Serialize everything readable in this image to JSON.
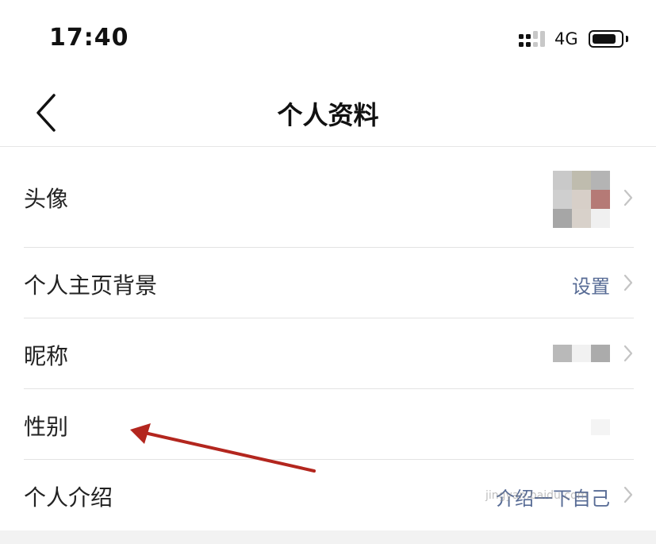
{
  "status_bar": {
    "time": "17:40",
    "network": "4G",
    "battery_level": 0.85
  },
  "nav": {
    "title": "个人资料",
    "back_icon": "chevron-left-icon"
  },
  "rows": [
    {
      "label": "头像",
      "value": "",
      "icon": "chevron-right-icon"
    },
    {
      "label": "个人主页背景",
      "value": "设置",
      "icon": "chevron-right-icon"
    },
    {
      "label": "昵称",
      "value": "",
      "icon": "chevron-right-icon"
    },
    {
      "label": "性别",
      "value": "",
      "icon": ""
    },
    {
      "label": "个人介绍",
      "value": "介绍一下自己",
      "icon": "chevron-right-icon"
    }
  ],
  "watermark": "jingyan.baidu.com",
  "colors": {
    "link": "#576b95",
    "annotation": "#b3261e",
    "divider": "#e3e3e3"
  }
}
